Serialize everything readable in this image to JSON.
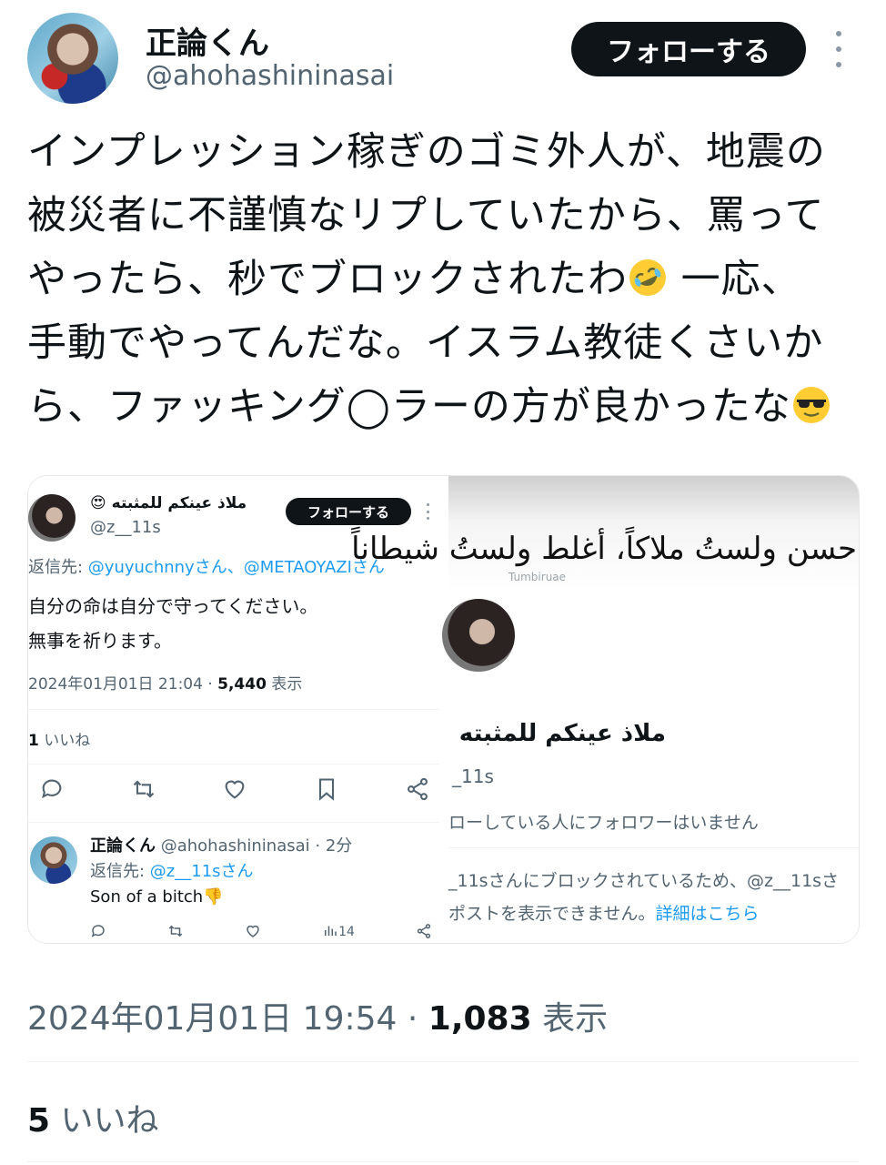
{
  "author": {
    "name": "正論くん",
    "handle": "@ahohashininasai"
  },
  "follow_label": "フォローする",
  "tweet_lines": [
    "インプレッション稼ぎのゴミ外人が、地震の",
    "被災者に不謹慎なリプしていたから、罵って",
    "やったら、秒でブロックされたわ",
    " 一応、",
    "手動でやってんだな。イスラム教徒くさいか",
    "ら、ファッキング◯ラーの方が良かったな"
  ],
  "media": {
    "left": {
      "name": "ملاذ عينكم للمثبته",
      "handle": "@z__11s",
      "follow": "フォローする",
      "reply_prefix": "返信先: ",
      "reply_mentions": "@yuyuchnnyさん、@METAOYAZIさん",
      "body1": "自分の命は自分で守ってください。",
      "body2": "無事を祈ります。",
      "meta_time": "2024年01月01日 21:04 · ",
      "meta_views": "5,440",
      "meta_views_label": " 表示",
      "likes_count": "1",
      "likes_label": " いいね",
      "reply": {
        "name": "正論くん",
        "handle": " @ahohashininasai · 2分",
        "reply_prefix": "返信先: ",
        "reply_mention": "@z__11sさん",
        "body": "Son of a bitch👎",
        "views": "14"
      }
    },
    "right": {
      "banner_text": "حسن ولستُ ملاكاً، أغلط ولستُ شيطاناً",
      "banner_sub": "Tumbiruae",
      "name": "ملاذ عينكم للمثبته",
      "handle": "_11s",
      "follow_text": "ローしている人にフォロワーはいません",
      "blocked1": "_11sさんにブロックされているため、@z__11sさ",
      "blocked2_prefix": "ポストを表示できません。",
      "blocked2_link": "詳細はこちら"
    }
  },
  "timestamp": {
    "time": "2024年01月01日 19:54 · ",
    "views": "1,083",
    "views_label": " 表示"
  },
  "likes": {
    "count": "5",
    "label": " いいね"
  }
}
